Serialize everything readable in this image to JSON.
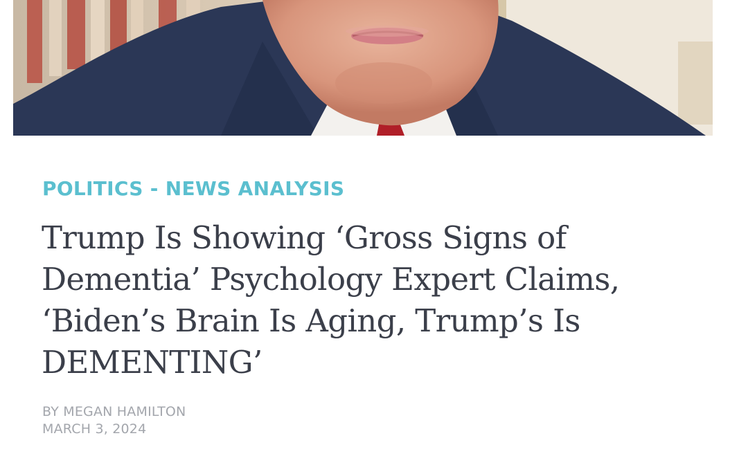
{
  "article": {
    "category": "POLITICS - NEWS ANALYSIS",
    "headline": "Trump Is Showing ‘Gross Signs of Dementia’ Psychology Expert Claims, ‘Biden’s Brain Is Aging, Trump’s Is DEMENTING’",
    "author": "BY MEGAN HAMILTON",
    "date": "MARCH 3, 2024"
  },
  "colors": {
    "category": "#5bbfcf",
    "headline": "#3b3f4a",
    "byline": "#a3a6ac"
  }
}
